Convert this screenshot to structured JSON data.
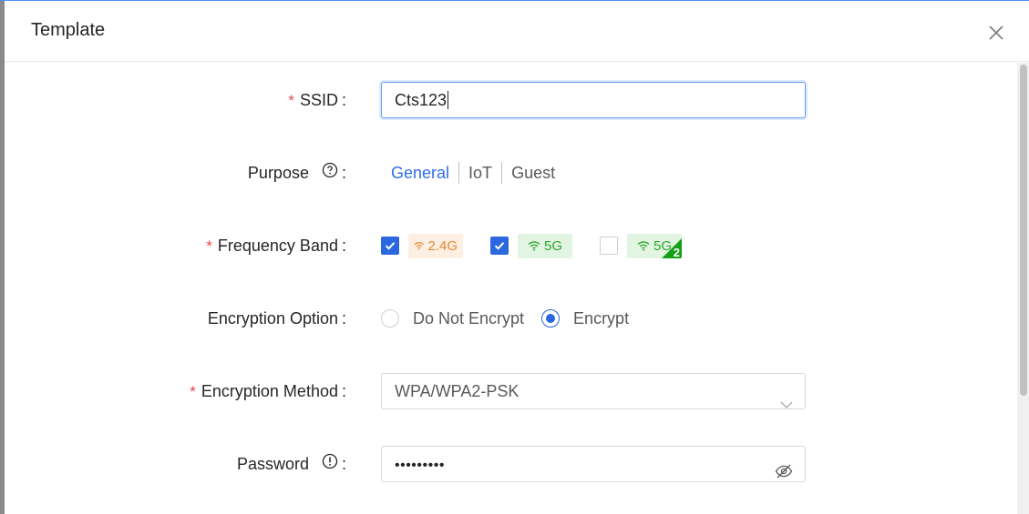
{
  "modal": {
    "title": "Template",
    "close_icon": "close-icon"
  },
  "form": {
    "ssid": {
      "label": "SSID",
      "required": "*",
      "colon": ":",
      "value": "Cts123"
    },
    "purpose": {
      "label": "Purpose",
      "colon": ":",
      "help_icon": "question-circle-icon",
      "options": [
        "General",
        "IoT",
        "Guest"
      ],
      "selected": "General"
    },
    "frequency_band": {
      "label": "Frequency Band",
      "required": "*",
      "colon": ":",
      "bands": [
        {
          "label": "2.4G",
          "checked": true,
          "color": "#e8862f",
          "icon": "wifi-icon"
        },
        {
          "label": "5G",
          "checked": true,
          "color": "#2ea62e",
          "icon": "wifi-icon"
        },
        {
          "label": "5G",
          "badge": "2",
          "checked": false,
          "color": "#2ea62e",
          "icon": "wifi-icon"
        }
      ]
    },
    "encryption_option": {
      "label": "Encryption Option",
      "colon": ":",
      "options": [
        "Do Not Encrypt",
        "Encrypt"
      ],
      "selected": "Encrypt"
    },
    "encryption_method": {
      "label": "Encryption Method",
      "required": "*",
      "colon": ":",
      "value": "WPA/WPA2-PSK",
      "icon": "chevron-down-icon"
    },
    "password": {
      "label": "Password",
      "colon": ":",
      "info_icon": "exclamation-circle-icon",
      "masked_value": "•••••••••",
      "toggle_icon": "eye-hidden-icon"
    }
  },
  "colors": {
    "primary": "#2b68e0",
    "required": "#e84545",
    "band_24": "#e8862f",
    "band_5": "#2ea62e"
  }
}
